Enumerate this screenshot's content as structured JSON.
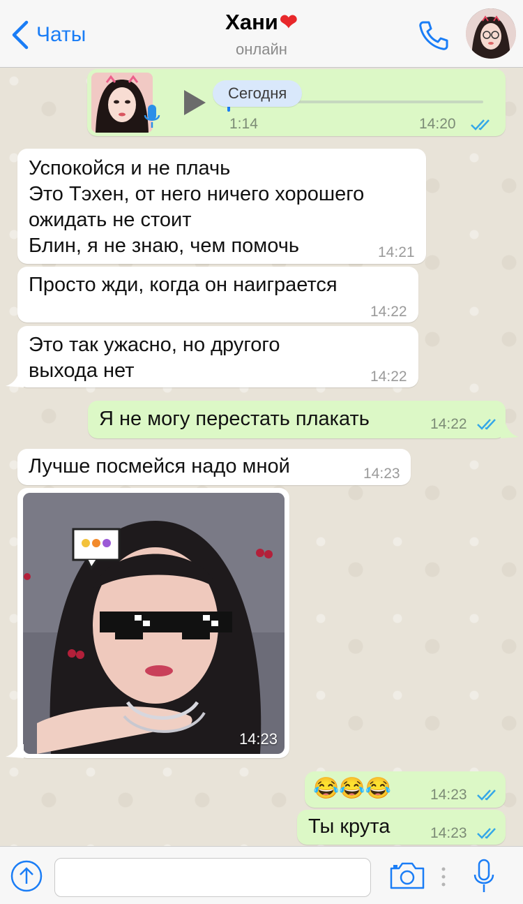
{
  "header": {
    "back_label": "Чаты",
    "contact_name": "Хани",
    "heart": "❤",
    "status": "онлайн"
  },
  "voice_message": {
    "chip_label": "Сегодня",
    "duration": "1:14",
    "time": "14:20",
    "read": true
  },
  "messages": [
    {
      "lines": [
        "Успокойся и не плачь",
        "Это Тэхен, от него ничего хорошего",
        "ожидать не стоит",
        "Блин, я не знаю, чем помочь"
      ],
      "time": "14:21"
    },
    {
      "lines": [
        "Просто жди, когда он наиграется"
      ],
      "time": "14:22"
    },
    {
      "lines": [
        "Это так ужасно, но другого",
        "выхода нет"
      ],
      "time": "14:22"
    },
    {
      "lines": [
        "Я не могу перестать плакать"
      ],
      "time": "14:22",
      "read": true
    },
    {
      "lines": [
        "Лучше посмейся надо мной"
      ],
      "time": "14:23"
    },
    {
      "photo": true,
      "time": "14:23"
    },
    {
      "lines": [
        "😂😂😂"
      ],
      "time": "14:23",
      "read": true
    },
    {
      "lines": [
        "Ты крута"
      ],
      "time": "14:23",
      "read": true
    }
  ],
  "colors": {
    "accent": "#1a7df6",
    "outgoing_bubble": "#dcf8c6",
    "incoming_bubble": "#ffffff",
    "tick_blue": "#34b7f1"
  },
  "icons": [
    "chevron-left-icon",
    "phone-icon",
    "play-icon",
    "mic-icon",
    "upload-icon",
    "camera-icon",
    "more-icon",
    "double-check-icon"
  ]
}
